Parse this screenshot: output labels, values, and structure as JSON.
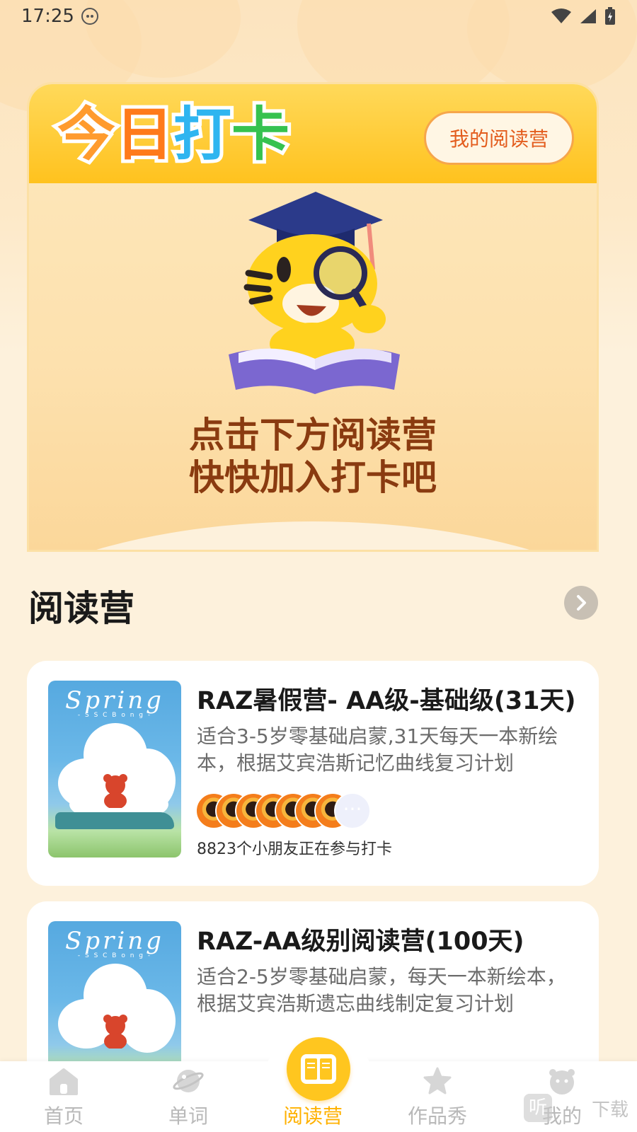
{
  "status_bar": {
    "time": "17:25"
  },
  "checkin": {
    "title_chars": [
      "今",
      "日",
      "打",
      "卡"
    ],
    "my_camp_label": "我的阅读营",
    "prompt_line1": "点击下方阅读营",
    "prompt_line2": "快快加入打卡吧"
  },
  "section": {
    "title": "阅读营"
  },
  "camps": [
    {
      "cover_title": "Spring",
      "cover_subtitle": "- S S C B o n g -",
      "title": "RAZ暑假营- AA级-基础级(31天)",
      "description": "适合3-5岁零基础启蒙,31天每天一本新绘本，根据艾宾浩斯记忆曲线复习计划",
      "participants": "8823个小朋友正在参与打卡"
    },
    {
      "cover_title": "Spring",
      "cover_subtitle": "- S S C B o n g -",
      "title": "RAZ-AA级别阅读营(100天)",
      "description": "适合2-5岁零基础启蒙，每天一本新绘本，根据艾宾浩斯遗忘曲线制定复习计划",
      "participants": ""
    }
  ],
  "bottom_nav": {
    "items": [
      {
        "label": "首页",
        "icon": "home-icon"
      },
      {
        "label": "单词",
        "icon": "planet-icon"
      },
      {
        "label": "阅读营",
        "icon": "book-icon"
      },
      {
        "label": "作品秀",
        "icon": "star-icon"
      },
      {
        "label": "我的",
        "icon": "profile-icon"
      }
    ],
    "active_index": 2
  },
  "watermark": {
    "badge": "听",
    "text": "下载"
  },
  "colors": {
    "accent": "#ffc61f",
    "active_label": "#ffb100",
    "prompt_text": "#8a3b10"
  }
}
